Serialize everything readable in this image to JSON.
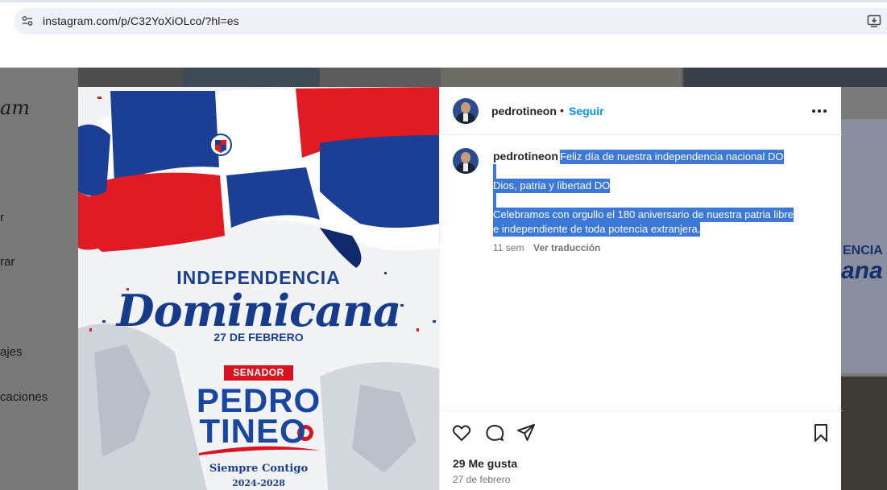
{
  "browser": {
    "url": "instagram.com/p/C32YoXiOLco/?hl=es"
  },
  "background": {
    "logo": "am",
    "nav_items": [
      "r",
      "rar",
      "ajes",
      "caciones"
    ],
    "right_card_top": "ENCIA",
    "right_card_bottom": "ana"
  },
  "poster": {
    "heading": "INDEPENDENCIA",
    "script_title": "Dominicana",
    "date": "27 DE FEBRERO",
    "badge": "SENADOR",
    "name_first": "PEDRO",
    "name_last": "TINEO",
    "slogan": "Siempre Contigo",
    "years": "2024-2028",
    "colors": {
      "blue": "#1946a0",
      "red": "#d7141f"
    }
  },
  "post": {
    "username": "pedrotineon",
    "separator": "•",
    "follow_label": "Seguir",
    "more_icon": "more-horizontal-icon",
    "caption": {
      "username": "pedrotineon",
      "line1": "Feliz día de nuestra independencia nacional DO",
      "line2": "Dios, patria y libertad DO",
      "line3": "Celebramos con orgullo el 180 aniversario de nuestra patria libre",
      "line4": "e independiente de toda potencia extranjera."
    },
    "time_ago": "11 sem",
    "translate_label": "Ver traducción",
    "likes": "29 Me gusta",
    "date": "27 de febrero",
    "link_color": "#0095f6",
    "selection_color": "#3b78d8"
  }
}
